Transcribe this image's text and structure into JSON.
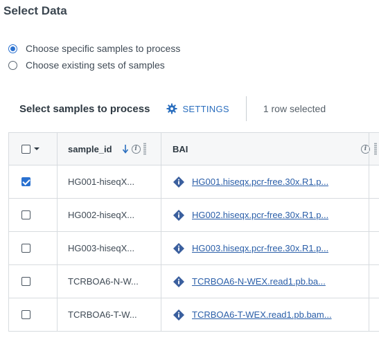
{
  "page": {
    "title": "Select Data"
  },
  "mode_options": [
    {
      "label": "Choose specific samples to process",
      "selected": true
    },
    {
      "label": "Choose existing sets of samples",
      "selected": false
    }
  ],
  "toolbar": {
    "title": "Select samples to process",
    "settings_label": "SETTINGS",
    "row_count_text": "1 row selected"
  },
  "grid": {
    "columns": {
      "sample_id": "sample_id",
      "bai": "BAI"
    },
    "rows": [
      {
        "selected": true,
        "sample_id": "HG001-hiseqX...",
        "bai": "HG001.hiseqx.pcr-free.30x.R1.p..."
      },
      {
        "selected": false,
        "sample_id": "HG002-hiseqX...",
        "bai": "HG002.hiseqx.pcr-free.30x.R1.p..."
      },
      {
        "selected": false,
        "sample_id": "HG003-hiseqX...",
        "bai": "HG003.hiseqx.pcr-free.30x.R1.p..."
      },
      {
        "selected": false,
        "sample_id": "TCRBOA6-N-W...",
        "bai": "TCRBOA6-N-WEX.read1.pb.ba..."
      },
      {
        "selected": false,
        "sample_id": "TCRBOA6-T-W...",
        "bai": "TCRBOA6-T-WEX.read1.pb.bam..."
      }
    ]
  },
  "colors": {
    "accent": "#2a71d0",
    "link": "#2a5ea8",
    "file_icon": "#3a5f9e"
  },
  "icons": {
    "settings": "gear-icon",
    "sort": "sort-down-arrow-icon",
    "info": "info-circle-icon",
    "file": "diamond-info-icon"
  }
}
